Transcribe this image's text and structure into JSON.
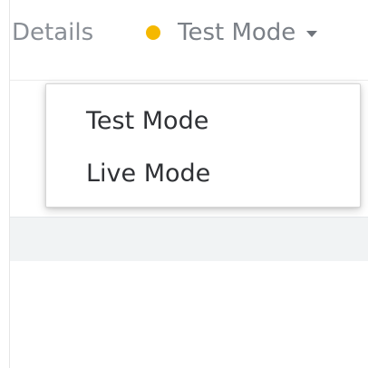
{
  "header": {
    "details_label": "Details",
    "mode_toggle": {
      "label": "Test Mode",
      "status_color": "#f5b800",
      "caret_icon": "caret-down-icon"
    }
  },
  "dropdown": {
    "items": [
      {
        "label": "Test Mode"
      },
      {
        "label": "Live Mode"
      }
    ]
  },
  "colors": {
    "status_dot": "#f5b800",
    "band": "#f1f3f4"
  }
}
